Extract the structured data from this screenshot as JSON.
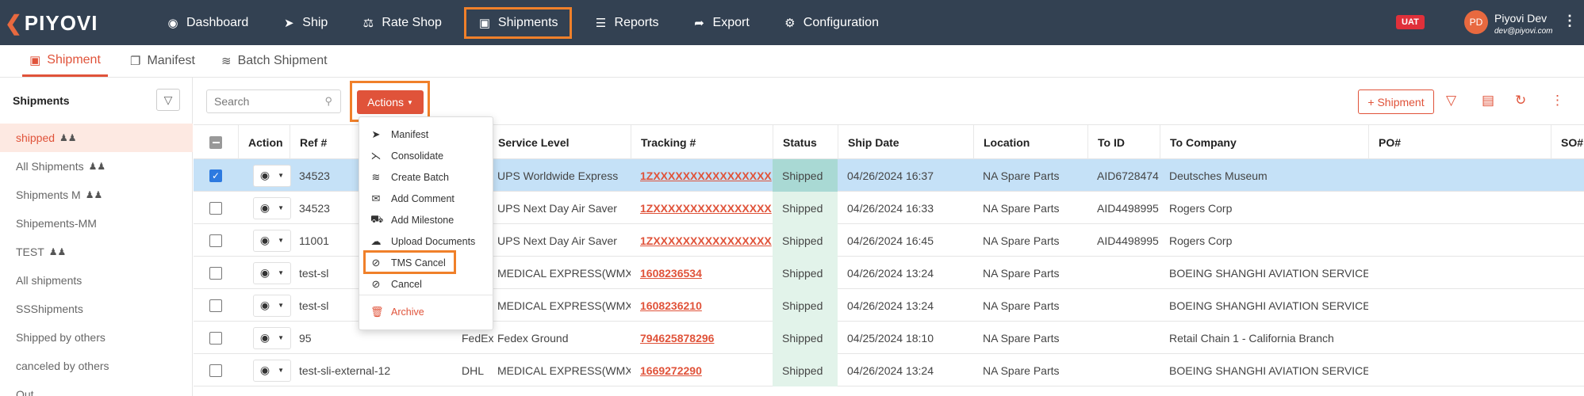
{
  "brand": {
    "logo": "PIYOVI"
  },
  "nav": [
    {
      "label": "Dashboard",
      "icon": "dashboard-icon",
      "active": false
    },
    {
      "label": "Ship",
      "icon": "ship-icon",
      "active": false
    },
    {
      "label": "Rate Shop",
      "icon": "scale-icon",
      "active": false
    },
    {
      "label": "Shipments",
      "icon": "shipments-icon",
      "active": true
    },
    {
      "label": "Reports",
      "icon": "reports-icon",
      "active": false
    },
    {
      "label": "Export",
      "icon": "export-icon",
      "active": false
    },
    {
      "label": "Configuration",
      "icon": "gear-icon",
      "active": false
    }
  ],
  "env_badge": "UAT",
  "user": {
    "initials": "PD",
    "name": "Piyovi Dev",
    "email": "dev@piyovi.com"
  },
  "subtabs": [
    {
      "label": "Shipment",
      "icon": "shipment-icon",
      "active": true
    },
    {
      "label": "Manifest",
      "icon": "manifest-icon",
      "active": false
    },
    {
      "label": "Batch Shipment",
      "icon": "batch-icon",
      "active": false
    }
  ],
  "sidebar": {
    "title": "Shipments",
    "items": [
      {
        "label": "shipped",
        "group": true,
        "active": true
      },
      {
        "label": "All Shipments",
        "group": true,
        "active": false
      },
      {
        "label": "Shipments M",
        "group": true,
        "active": false
      },
      {
        "label": "Shipements-MM",
        "group": false,
        "active": false
      },
      {
        "label": "TEST",
        "group": true,
        "active": false
      },
      {
        "label": "All shipments",
        "group": false,
        "active": false
      },
      {
        "label": "SSShipments",
        "group": false,
        "active": false
      },
      {
        "label": "Shipped by others",
        "group": false,
        "active": false
      },
      {
        "label": "canceled by others",
        "group": false,
        "active": false
      },
      {
        "label": "Out",
        "group": false,
        "active": false
      }
    ]
  },
  "toolbar": {
    "search_placeholder": "Search",
    "actions_label": "Actions",
    "add_shipment_label": "+ Shipment"
  },
  "actions_menu": [
    {
      "label": "Manifest",
      "icon": "manifest-arrow-icon"
    },
    {
      "label": "Consolidate",
      "icon": "consolidate-icon"
    },
    {
      "label": "Create Batch",
      "icon": "batch-icon"
    },
    {
      "label": "Add Comment",
      "icon": "comment-icon"
    },
    {
      "label": "Add Milestone",
      "icon": "truck-icon"
    },
    {
      "label": "Upload Documents",
      "icon": "cloud-upload-icon"
    },
    {
      "label": "TMS Cancel",
      "icon": "ban-icon"
    },
    {
      "label": "Cancel",
      "icon": "ban-icon"
    },
    {
      "label": "Archive",
      "icon": "trash-icon"
    }
  ],
  "table": {
    "columns": [
      "Action",
      "Ref #",
      "",
      "Service Level",
      "Tracking #",
      "Status",
      "Ship Date",
      "Location",
      "To ID",
      "To Company",
      "PO#",
      "SO#"
    ],
    "rows": [
      {
        "checked": true,
        "ref": "34523",
        "carrier": "",
        "service": "UPS Worldwide Express",
        "tracking": "1ZXXXXXXXXXXXXXXXX",
        "status": "Shipped",
        "date": "04/26/2024 16:37",
        "location": "NA Spare Parts",
        "to_id": "AID6728474",
        "company": "Deutsches Museum"
      },
      {
        "checked": false,
        "ref": "34523",
        "carrier": "",
        "service": "UPS Next Day Air Saver",
        "tracking": "1ZXXXXXXXXXXXXXXXX",
        "status": "Shipped",
        "date": "04/26/2024 16:33",
        "location": "NA Spare Parts",
        "to_id": "AID4498995",
        "company": "Rogers Corp"
      },
      {
        "checked": false,
        "ref": "11001",
        "carrier": "",
        "service": "UPS Next Day Air Saver",
        "tracking": "1ZXXXXXXXXXXXXXXXX",
        "status": "Shipped",
        "date": "04/26/2024 16:45",
        "location": "NA Spare Parts",
        "to_id": "AID4498995",
        "company": "Rogers Corp"
      },
      {
        "checked": false,
        "ref": "test-sl",
        "carrier": "",
        "service": "MEDICAL EXPRESS(WMX)",
        "tracking": "1608236534",
        "status": "Shipped",
        "date": "04/26/2024 13:24",
        "location": "NA Spare Parts",
        "to_id": "",
        "company": "BOEING SHANGHI AVIATION SERVICES"
      },
      {
        "checked": false,
        "ref": "test-sl",
        "carrier": "",
        "service": "MEDICAL EXPRESS(WMX)",
        "tracking": "1608236210",
        "status": "Shipped",
        "date": "04/26/2024 13:24",
        "location": "NA Spare Parts",
        "to_id": "",
        "company": "BOEING SHANGHI AVIATION SERVICES"
      },
      {
        "checked": false,
        "ref": "95",
        "carrier": "FedEx",
        "service": "Fedex Ground",
        "tracking": "794625878296",
        "status": "Shipped",
        "date": "04/25/2024 18:10",
        "location": "NA Spare Parts",
        "to_id": "",
        "company": "Retail Chain 1 - California Branch"
      },
      {
        "checked": false,
        "ref": "test-sli-external-12",
        "carrier": "DHL",
        "service": "MEDICAL EXPRESS(WMX)",
        "tracking": "1669272290",
        "status": "Shipped",
        "date": "04/26/2024 13:24",
        "location": "NA Spare Parts",
        "to_id": "",
        "company": "BOEING SHANGHI AVIATION SERVICES"
      }
    ]
  }
}
